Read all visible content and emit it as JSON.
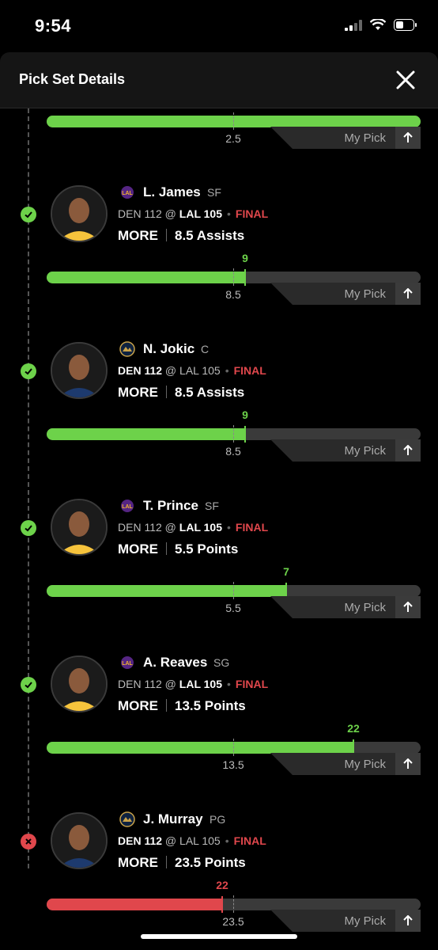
{
  "status_bar": {
    "time": "9:54"
  },
  "header": {
    "title": "Pick Set Details"
  },
  "top_partial": {
    "line": "2.5",
    "my_pick_label": "My Pick",
    "progress_fraction": 1.0
  },
  "picks": [
    {
      "name": "L. James",
      "position": "SF",
      "team": "LAL",
      "away": "DEN 112",
      "home": "LAL 105",
      "bold": "home",
      "status": "FINAL",
      "direction": "MORE",
      "stat_line": "8.5 Assists",
      "result": "9",
      "line": "8.5",
      "outcome": "win",
      "my_pick_label": "My Pick"
    },
    {
      "name": "N. Jokic",
      "position": "C",
      "team": "DEN",
      "away": "DEN 112",
      "home": "LAL 105",
      "bold": "away",
      "status": "FINAL",
      "direction": "MORE",
      "stat_line": "8.5 Assists",
      "result": "9",
      "line": "8.5",
      "outcome": "win",
      "my_pick_label": "My Pick"
    },
    {
      "name": "T. Prince",
      "position": "SF",
      "team": "LAL",
      "away": "DEN 112",
      "home": "LAL 105",
      "bold": "home",
      "status": "FINAL",
      "direction": "MORE",
      "stat_line": "5.5 Points",
      "result": "7",
      "line": "5.5",
      "outcome": "win",
      "my_pick_label": "My Pick"
    },
    {
      "name": "A. Reaves",
      "position": "SG",
      "team": "LAL",
      "away": "DEN 112",
      "home": "LAL 105",
      "bold": "home",
      "status": "FINAL",
      "direction": "MORE",
      "stat_line": "13.5 Points",
      "result": "22",
      "line": "13.5",
      "outcome": "win",
      "my_pick_label": "My Pick"
    },
    {
      "name": "J. Murray",
      "position": "PG",
      "team": "DEN",
      "away": "DEN 112",
      "home": "LAL 105",
      "bold": "away",
      "status": "FINAL",
      "direction": "MORE",
      "stat_line": "23.5 Points",
      "result": "22",
      "line": "23.5",
      "outcome": "loss",
      "my_pick_label": "My Pick"
    }
  ],
  "progress_fractions": [
    0.53,
    0.53,
    0.64,
    0.82,
    0.47
  ],
  "colors": {
    "win": "#6dd24a",
    "loss": "#e0474c",
    "lakers": "#f0b330",
    "nuggets": "#c8a24a"
  },
  "icons": {
    "close": "close-icon",
    "check": "check-icon",
    "x": "x-mark-icon",
    "arrow": "arrow-up-icon"
  }
}
